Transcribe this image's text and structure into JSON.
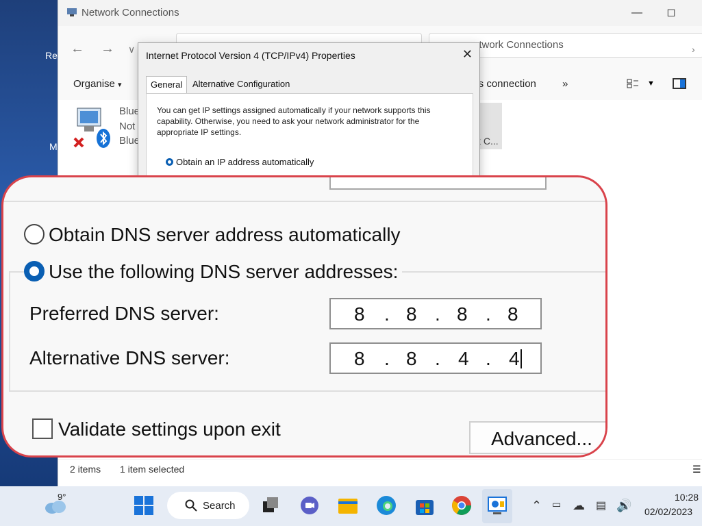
{
  "desktop": {
    "frag_1": "Re",
    "frag_2": "M"
  },
  "explorer": {
    "title": "Network Connections",
    "search_text": "etwork Connections",
    "toolbar": {
      "organise": "Organise",
      "organise_arrow": "▾",
      "this_connection": "his connection",
      "more": "»"
    },
    "connection": {
      "name": "Blue",
      "status": "Not",
      "device": "Blue"
    },
    "selected_item_fragment": "k C...",
    "status": {
      "items": "2 items",
      "selected": "1 item selected"
    }
  },
  "dialog": {
    "title": "Internet Protocol Version 4 (TCP/IPv4) Properties",
    "tabs": [
      {
        "label": "General"
      },
      {
        "label": "Alternative Configuration"
      }
    ],
    "description": "You can get IP settings assigned automatically if your network supports this capability. Otherwise, you need to ask your network administrator for the appropriate IP settings.",
    "obtain_ip_auto": "Obtain an IP address automatically"
  },
  "zoom": {
    "obtain_dns_auto": "Obtain DNS server address automatically",
    "use_following_dns": "Use the following DNS server addresses:",
    "preferred_label": "Preferred DNS server:",
    "alternative_label": "Alternative DNS server:",
    "preferred_ip": [
      "8",
      ".",
      "8",
      ".",
      "8",
      ".",
      "8"
    ],
    "alternative_ip": [
      "8",
      ".",
      "8",
      ".",
      "4",
      ".",
      "4"
    ],
    "validate_label": "Validate settings upon exit",
    "advanced_label": "Advanced..."
  },
  "taskbar": {
    "weather_temp": "9°",
    "search_label": "Search",
    "time": "10:28",
    "date": "02/02/2023"
  },
  "colors": {
    "accent": "#0a5fb3",
    "callout_border": "#d9434b"
  }
}
